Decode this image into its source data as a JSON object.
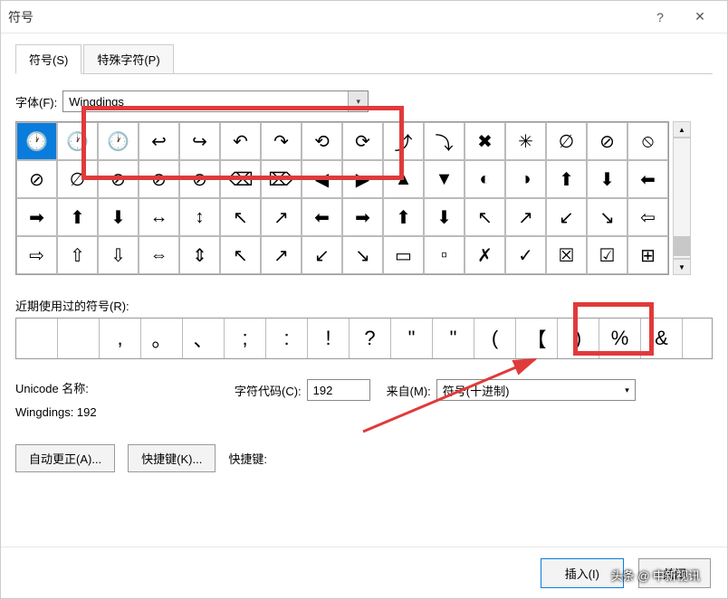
{
  "window": {
    "title": "符号",
    "help": "?",
    "close": "✕"
  },
  "tabs": {
    "symbols": "符号(S)",
    "special": "特殊字符(P)"
  },
  "font": {
    "label": "字体(F):",
    "value": "Wingdings"
  },
  "grid": {
    "rows": [
      [
        "🕐",
        "🕐",
        "🕐",
        "↩",
        "↪",
        "↶",
        "↷",
        "⟲",
        "⟳",
        "⤴",
        "⤵",
        "✖",
        "✳",
        "∅",
        "⊘",
        "⦸"
      ],
      [
        "⊘",
        "∅",
        "⊘",
        "⊘",
        "⊘",
        "⌫",
        "⌦",
        "◀",
        "▶",
        "▲",
        "▼",
        "◐",
        "◑",
        "⬆",
        "⬇",
        "⬅"
      ],
      [
        "➡",
        "⬆",
        "⬇",
        "↔",
        "↕",
        "↖",
        "↗",
        "⬅",
        "➡",
        "⬆",
        "⬇",
        "↖",
        "↗",
        "↙",
        "↘",
        "⇦"
      ],
      [
        "⇨",
        "⇧",
        "⇩",
        "⇔",
        "⇕",
        "↖",
        "↗",
        "↙",
        "↘",
        "▭",
        "▫",
        "✗",
        "✓",
        "☒",
        "☑",
        "⊞"
      ]
    ],
    "selected": [
      0,
      0
    ]
  },
  "recent": {
    "label": "近期使用过的符号(R):",
    "items": [
      "",
      "",
      ",",
      "。",
      "、",
      ";",
      ":",
      "!",
      "?",
      "\"",
      "\"",
      "(",
      "【",
      ")",
      "%",
      "&"
    ]
  },
  "info": {
    "unicode_label": "Unicode 名称:",
    "unicode_value": "Wingdings: 192",
    "code_label": "字符代码(C):",
    "code_value": "192",
    "from_label": "来自(M):",
    "from_value": "符号(十进制)"
  },
  "buttons": {
    "autocorrect": "自动更正(A)...",
    "shortcut": "快捷键(K)...",
    "shortcut_label": "快捷键:",
    "insert": "插入(I)",
    "cancel": "关闭"
  },
  "watermark": "头条 @ 中新视讯"
}
